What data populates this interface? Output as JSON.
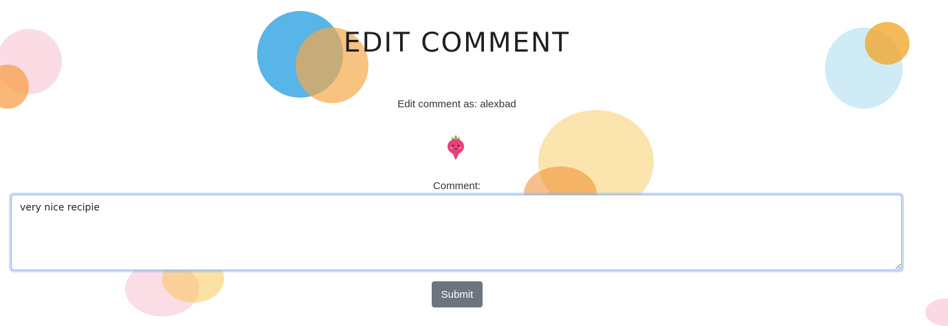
{
  "page": {
    "title": "EDIT COMMENT",
    "edit_as_text": "Edit comment as: alexbad",
    "avatar_icon": "radish-mascot-icon"
  },
  "form": {
    "comment_label": "Comment:",
    "comment_value": "very nice recipie",
    "submit_label": "Submit"
  },
  "colors": {
    "button": "#6c757d",
    "focus_ring": "#8ab4f0",
    "blob_blue": "#2a9fe0",
    "blob_orange": "#f39a2a",
    "blob_yellow": "#f7c34a",
    "blob_pink": "#f7b3c8",
    "blob_lightblue": "#a8dcee"
  }
}
